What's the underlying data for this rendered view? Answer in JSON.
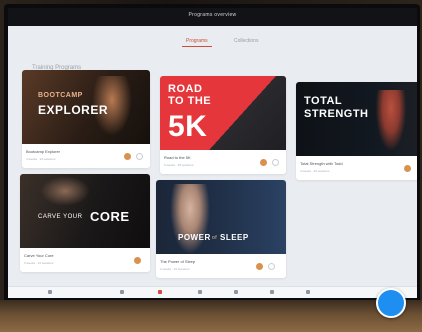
{
  "topbar": {
    "title": "Programs overview"
  },
  "tabs": {
    "active_label": "Programs",
    "other_label": "Collections"
  },
  "section": {
    "title": "Training Programs"
  },
  "cards": [
    {
      "thumb_line1": "BOOTCAMP",
      "thumb_line2": "EXPLORER",
      "meta_title": "Bootcamp Explorer",
      "meta_sub": "4 weeks · 24 sessions",
      "thumb_color": "#2a1d16"
    },
    {
      "thumb_line1": "ROAD",
      "thumb_line2": "TO THE",
      "thumb_line3": "5K",
      "meta_title": "Road to the 5K",
      "meta_sub": "6 weeks · 18 sessions",
      "thumb_color": "#e5373b"
    },
    {
      "thumb_line1": "TOTAL",
      "thumb_line2": "STRENGTH",
      "meta_title": "Total Strength with Todd",
      "meta_sub": "4 weeks · 20 sessions",
      "thumb_color": "#0e1217"
    },
    {
      "thumb_line1": "CARVE YOUR",
      "thumb_line2": "CORE",
      "meta_title": "Carve Your Core",
      "meta_sub": "3 weeks · 12 sessions",
      "thumb_color": "#1a1818"
    },
    {
      "thumb_line1": "POWER",
      "thumb_line2": "SLEEP",
      "thumb_mid": "of",
      "meta_title": "The Power of Sleep",
      "meta_sub": "2 weeks · 10 sessions",
      "thumb_color": "#203048"
    }
  ],
  "colors": {
    "accent": "#d24a3b",
    "fab": "#1e8ff0"
  },
  "icons": [
    "avatar-icon",
    "check-circle-icon",
    "home-icon",
    "fab-button"
  ]
}
